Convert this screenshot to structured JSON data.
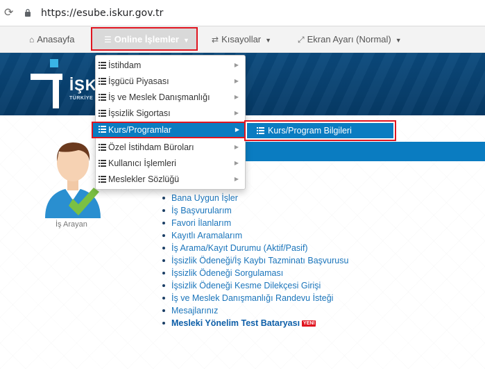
{
  "browser": {
    "url": "https://esube.iskur.gov.tr"
  },
  "nav": {
    "home": "Anasayfa",
    "online": "Online İşlemler",
    "shortcuts": "Kısayollar",
    "screen": "Ekran Ayarı (Normal)"
  },
  "logo": {
    "text": "İŞK",
    "sub": "TÜRKİYE"
  },
  "dropdown": {
    "items": [
      "İstihdam",
      "İşgücü Piyasası",
      "İş ve Meslek Danışmanlığı",
      "İşsizlik Sigortası",
      "Kurs/Programlar",
      "Özel İstihdam Büroları",
      "Kullanıcı İşlemleri",
      "Meslekler Sözlüğü"
    ],
    "active_index": 4
  },
  "submenu": {
    "item": "Kurs/Program Bilgileri"
  },
  "profile": {
    "label": "İş Arayan"
  },
  "links": [
    "Bana Uygun İşler",
    "İş Başvurularım",
    "Favori İlanlarım",
    "Kayıtlı Aramalarım",
    "İş Arama/Kayıt Durumu (Aktif/Pasif)",
    "İşsizlik Ödeneği/İş Kaybı Tazminatı Başvurusu",
    "İşsizlik Ödeneği Sorgulaması",
    "İşsizlik Ödeneği Kesme Dilekçesi Girişi",
    "İş ve Meslek Danışmanlığı Randevu İsteği",
    "Mesajlarınız",
    "Mesleki Yönelim Test Bataryası"
  ],
  "new_badge": "YENİ",
  "colors": {
    "accent_blue": "#0a7cc1",
    "highlight_red": "#e0141f",
    "banner": "#0b4a7d"
  }
}
